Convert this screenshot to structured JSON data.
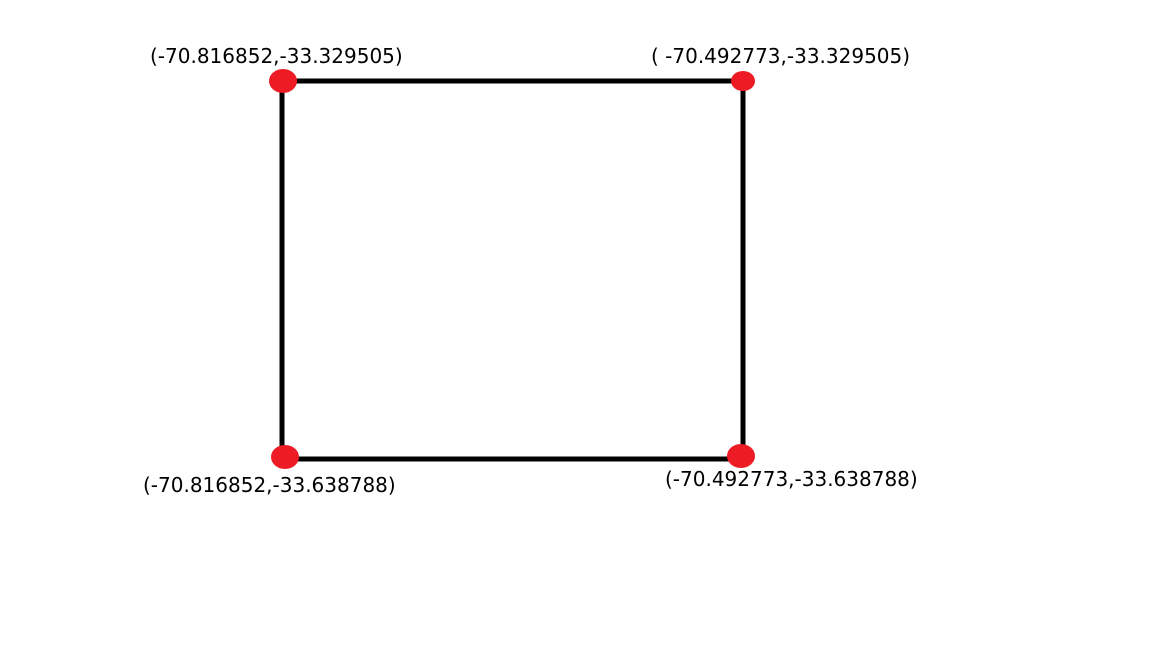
{
  "diagram": {
    "edge_color": "#000000",
    "point_color": "#ed1c24",
    "corners": [
      {
        "id": "top-left",
        "label": "(-70.816852,-33.329505)"
      },
      {
        "id": "top-right",
        "label": "( -70.492773,-33.329505)"
      },
      {
        "id": "bottom-left",
        "label": "(-70.816852,-33.638788)"
      },
      {
        "id": "bottom-right",
        "label": "(-70.492773,-33.638788)"
      }
    ]
  }
}
